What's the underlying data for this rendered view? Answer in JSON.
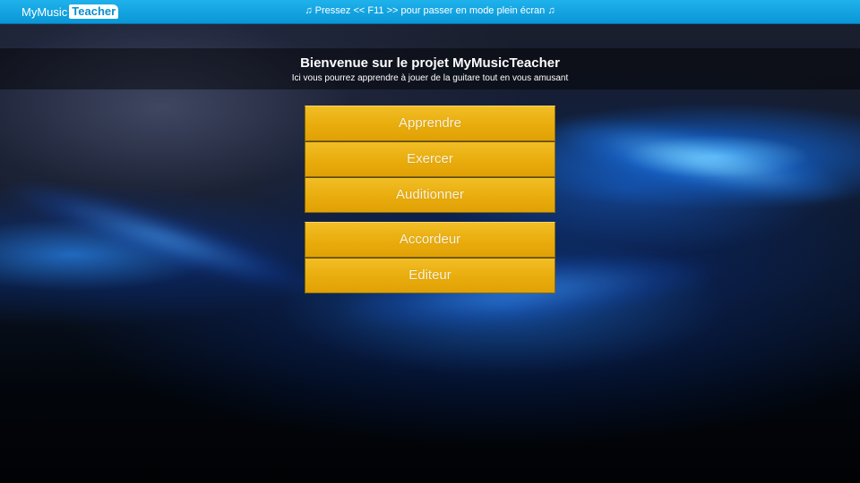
{
  "topbar": {
    "logo_part1": "MyMusic",
    "logo_part2": "Teacher",
    "notice": "♫ Pressez << F11 >> pour passer en mode plein écran ♫"
  },
  "header": {
    "title": "Bienvenue sur le projet MyMusicTeacher",
    "subtitle": "Ici vous pourrez apprendre à jouer de la guitare tout en vous amusant"
  },
  "menu": {
    "group1": [
      {
        "label": "Apprendre"
      },
      {
        "label": "Exercer"
      },
      {
        "label": "Auditionner"
      }
    ],
    "group2": [
      {
        "label": "Accordeur"
      },
      {
        "label": "Editeur"
      }
    ]
  },
  "colors": {
    "topbar": "#0a96d6",
    "button": "#e9ac0c",
    "button_text": "#fbf4de"
  }
}
